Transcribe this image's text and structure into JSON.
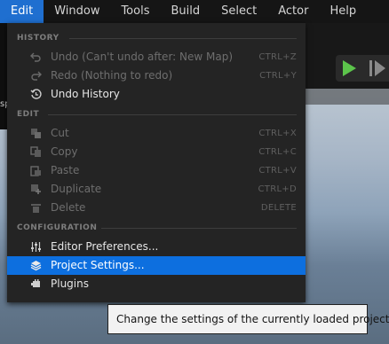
{
  "menubar": {
    "items": [
      "Edit",
      "Window",
      "Tools",
      "Build",
      "Select",
      "Actor",
      "Help"
    ],
    "active": "Edit"
  },
  "background": {
    "left_strip_text": "sp"
  },
  "edit_menu": {
    "sections": {
      "history": "HISTORY",
      "edit": "EDIT",
      "configuration": "CONFIGURATION"
    },
    "items": {
      "undo": {
        "label": "Undo (Can't undo after: New Map)",
        "shortcut": "CTRL+Z",
        "enabled": false,
        "icon": "undo-icon"
      },
      "redo": {
        "label": "Redo (Nothing to redo)",
        "shortcut": "CTRL+Y",
        "enabled": false,
        "icon": "redo-icon"
      },
      "undo_history": {
        "label": "Undo History",
        "shortcut": "",
        "enabled": true,
        "icon": "history-icon"
      },
      "cut": {
        "label": "Cut",
        "shortcut": "CTRL+X",
        "enabled": false,
        "icon": "cut-icon"
      },
      "copy": {
        "label": "Copy",
        "shortcut": "CTRL+C",
        "enabled": false,
        "icon": "copy-icon"
      },
      "paste": {
        "label": "Paste",
        "shortcut": "CTRL+V",
        "enabled": false,
        "icon": "paste-icon"
      },
      "duplicate": {
        "label": "Duplicate",
        "shortcut": "CTRL+D",
        "enabled": false,
        "icon": "duplicate-icon"
      },
      "delete": {
        "label": "Delete",
        "shortcut": "DELETE",
        "enabled": false,
        "icon": "delete-icon"
      },
      "editor_prefs": {
        "label": "Editor Preferences...",
        "shortcut": "",
        "enabled": true,
        "icon": "sliders-icon"
      },
      "project_settings": {
        "label": "Project Settings...",
        "shortcut": "",
        "enabled": true,
        "icon": "project-settings-icon",
        "highlighted": true
      },
      "plugins": {
        "label": "Plugins",
        "shortcut": "",
        "enabled": true,
        "icon": "plugin-icon"
      }
    }
  },
  "tooltip": {
    "text": "Change the settings of the currently loaded project."
  },
  "colors": {
    "menubar_active": "#1f6fd0",
    "menu_highlight": "#0d6fdf",
    "menu_bg": "#242424",
    "play_green": "#5cc44b"
  }
}
